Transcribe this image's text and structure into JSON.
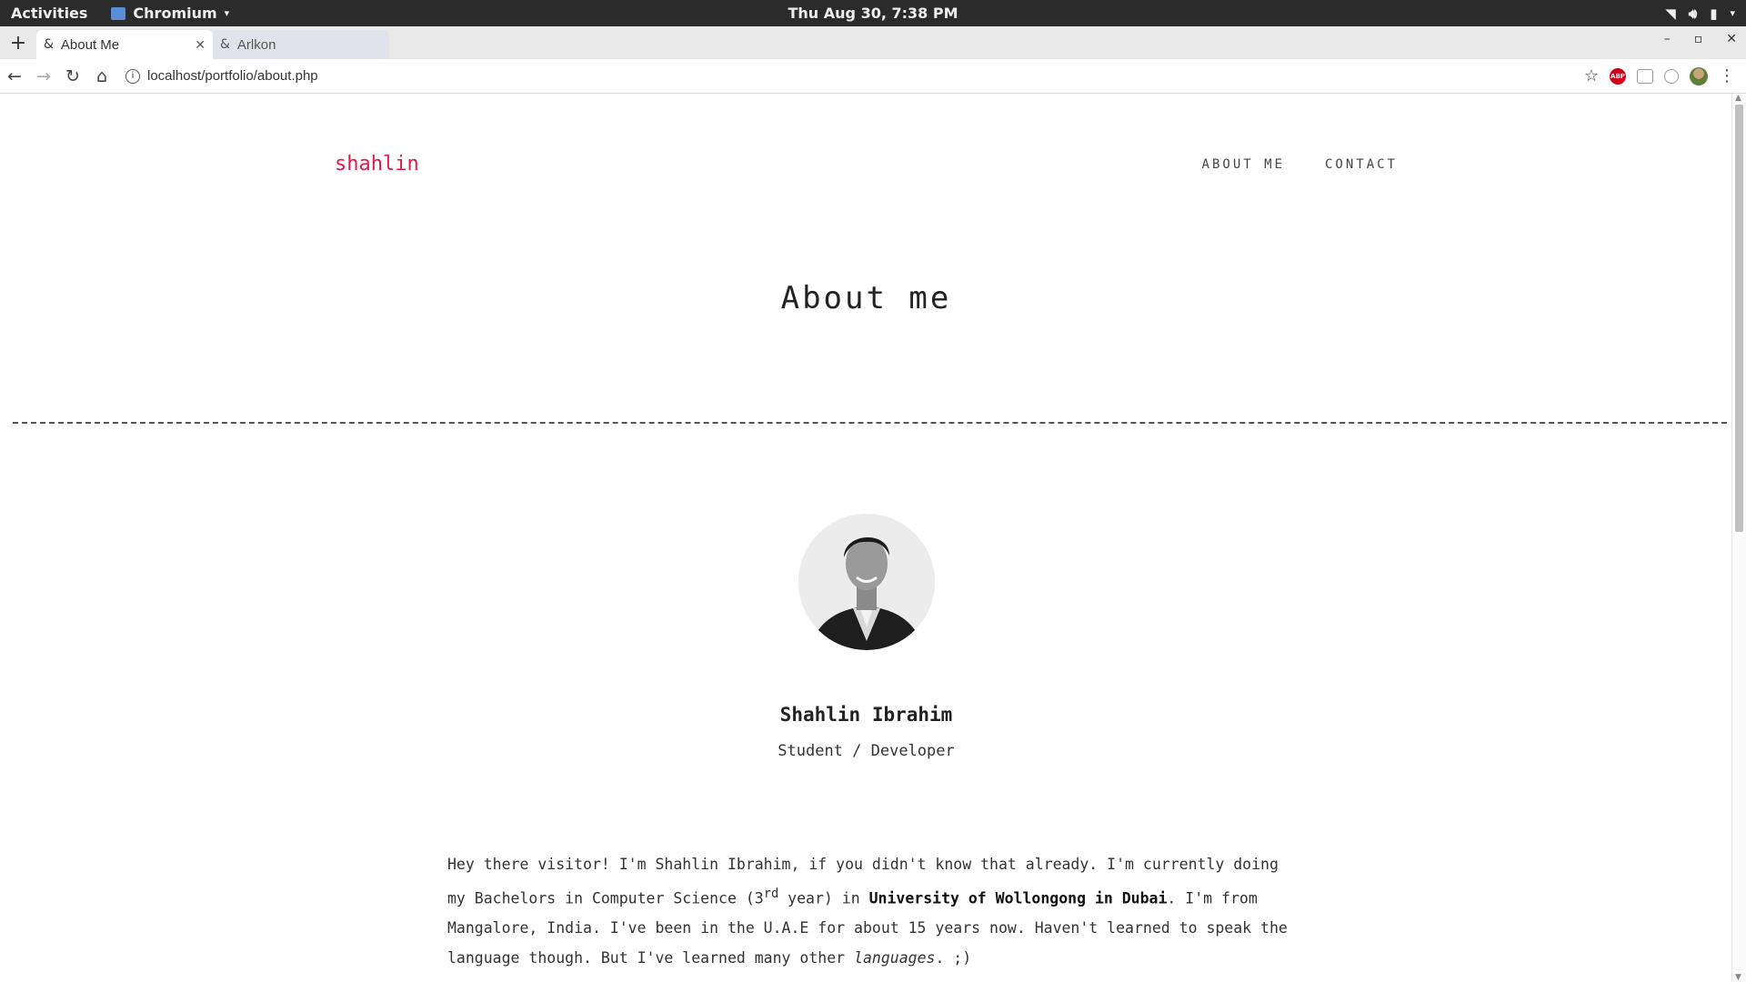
{
  "system": {
    "activities": "Activities",
    "app_name": "Chromium",
    "clock": "Thu Aug 30,  7:38 PM"
  },
  "browser": {
    "tabs": [
      {
        "title": "About Me",
        "active": true
      },
      {
        "title": "Arlkon",
        "active": false
      }
    ],
    "url": "localhost/portfolio/about.php"
  },
  "site": {
    "logo": "shahlin",
    "nav": [
      "ABOUT ME",
      "CONTACT"
    ],
    "page_title": "About me",
    "profile": {
      "name": "Shahlin Ibrahim",
      "role": "Student / Developer"
    },
    "bio": {
      "part1": "Hey there visitor! I'm Shahlin Ibrahim, if you didn't know that already. I'm currently doing my Bachelors in Computer Science (3",
      "sup": "rd",
      "part2": " year) in ",
      "bold": "University of Wollongong in Dubai",
      "part3": ". I'm from Mangalore, India. I've been in the U.A.E for about 15 years now. Haven't learned to speak the language though. But I've learned many other ",
      "italic": "languages",
      "part4": ". ;)"
    }
  },
  "colors": {
    "brand": "#e01b4a",
    "topbar": "#2b2b2b"
  }
}
